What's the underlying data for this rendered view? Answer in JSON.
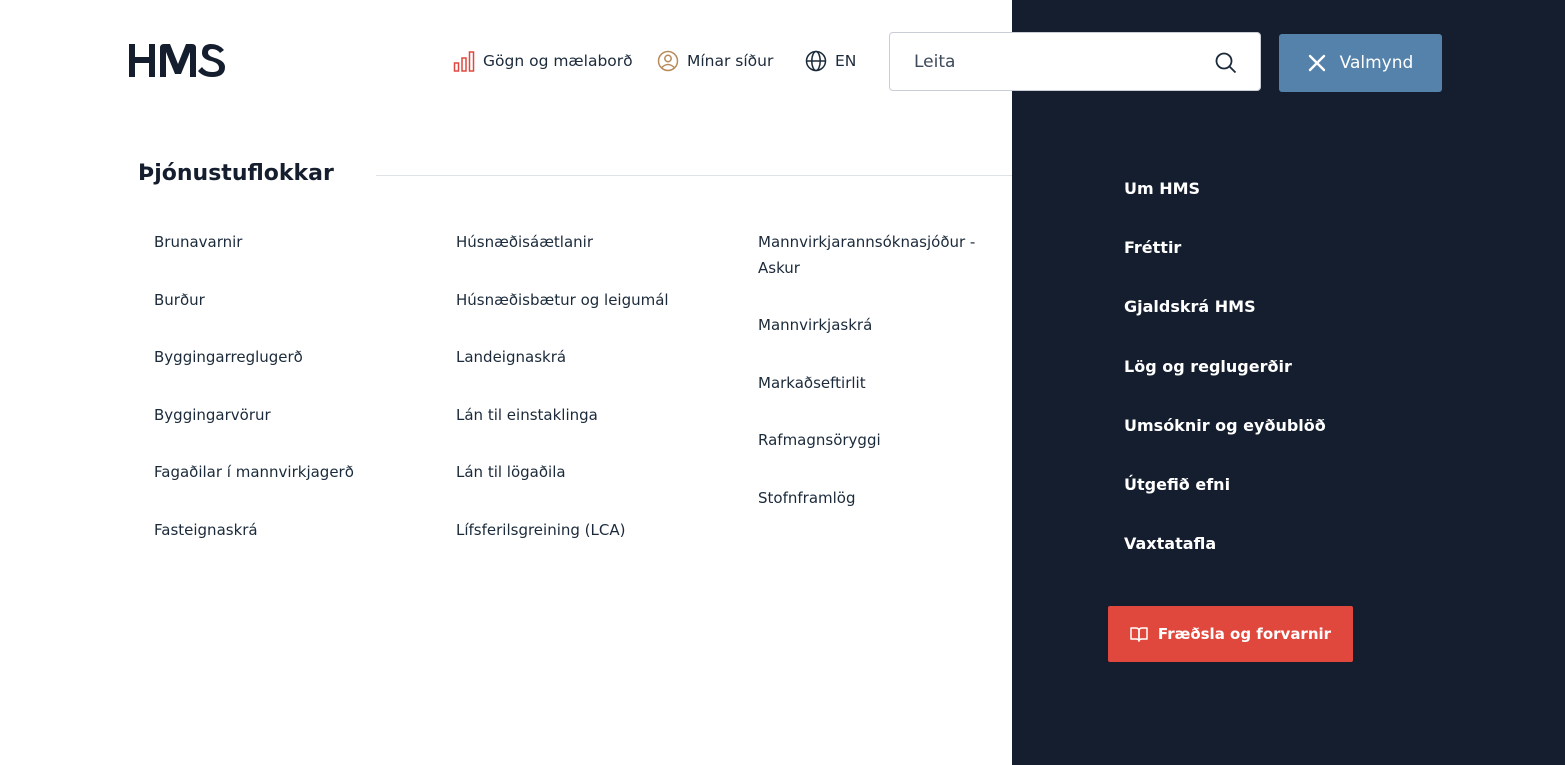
{
  "header": {
    "logo_text": "HMS",
    "links": [
      {
        "label": "Gögn og mælaborð",
        "icon": "bar-chart-icon"
      },
      {
        "label": "Mínar síður",
        "icon": "user-circle-icon"
      },
      {
        "label": "EN",
        "icon": "globe-icon"
      }
    ],
    "search": {
      "placeholder": "Leita",
      "icon": "search-icon"
    },
    "menu_button": {
      "label": "Valmynd",
      "icon": "close-icon"
    }
  },
  "categories": {
    "title": "Þjónustuflokkar",
    "col1": [
      "Brunavarnir",
      "Burður",
      "Byggingarreglugerð",
      "Byggingarvörur",
      "Fagaðilar í mannvirkjagerð",
      "Fasteignaskrá"
    ],
    "col2": [
      "Húsnæðisáætlanir",
      "Húsnæðisbætur og leigumál",
      "Landeignaskrá",
      "Lán til einstaklinga",
      "Lán til lögaðila",
      "Lífsferilsgreining (LCA)"
    ],
    "col3_first_line1": "Mannvirkjarannsóknasjóður -",
    "col3_first_line2": "Askur",
    "col3": [
      "Mannvirkjaskrá",
      "Markaðseftirlit",
      "Rafmagnsöryggi",
      "Stofnframlög"
    ]
  },
  "sidebar": {
    "items": [
      "Um HMS",
      "Fréttir",
      "Gjaldskrá HMS",
      "Lög og reglugerðir",
      "Umsóknir og eyðublöð",
      "Útgefið efni",
      "Vaxtatafla"
    ],
    "cta": {
      "label": "Fræðsla og forvarnir",
      "icon": "book-open-icon"
    }
  },
  "colors": {
    "dark_panel": "#141e2e",
    "menu_button": "#5582ab",
    "cta": "#e0483e",
    "chart_icon": "#e0483e",
    "user_icon": "#b88a5a"
  }
}
